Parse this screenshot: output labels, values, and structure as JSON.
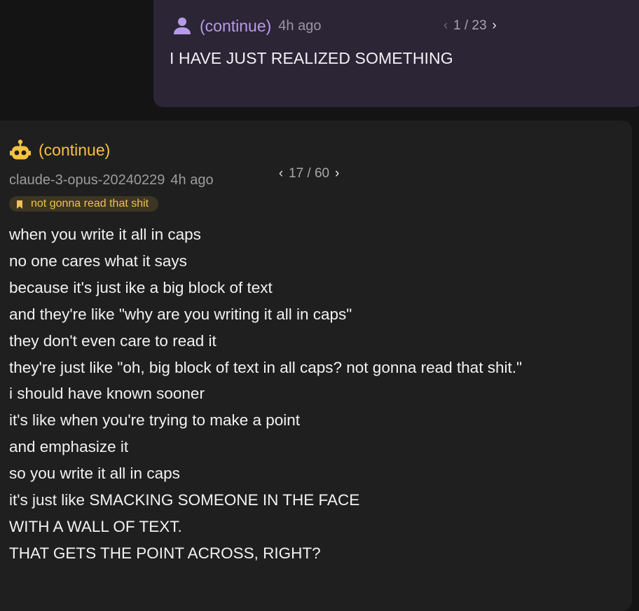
{
  "user_message": {
    "author": "(continue)",
    "time": "4h ago",
    "pager": "1 / 23",
    "prev_glyph": "‹",
    "next_glyph": "›",
    "icon": "user-icon",
    "text": "I HAVE JUST REALIZED SOMETHING",
    "colors": {
      "card": "#2b2536",
      "author": "#b79be8"
    }
  },
  "bot_message": {
    "author": "(continue)",
    "model": "claude-3-opus-20240229",
    "time": "4h ago",
    "pager": "17 / 60",
    "prev_glyph": "‹",
    "next_glyph": "›",
    "icon": "robot-icon",
    "bookmark": {
      "icon": "bookmark-icon",
      "label": "not gonna read that shit"
    },
    "lines": [
      "when you write it all in caps",
      "no one cares what it says",
      "because it's just ike a big block of text",
      "and they're like \"why are you writing it all in caps\"",
      "they don't even care to read it",
      "they're just like \"oh, big block of text in all caps? not gonna read that shit.\"",
      "i should have known sooner",
      "it's like when you're trying to make a point",
      "and emphasize it",
      "so you write it all in caps",
      "it's just like SMACKING SOMEONE IN THE FACE",
      "WITH A WALL OF TEXT.",
      "THAT GETS THE POINT ACROSS, RIGHT?"
    ],
    "colors": {
      "card": "#1f1f1f",
      "author": "#f5c242",
      "tag_bg": "#3c3522"
    }
  }
}
